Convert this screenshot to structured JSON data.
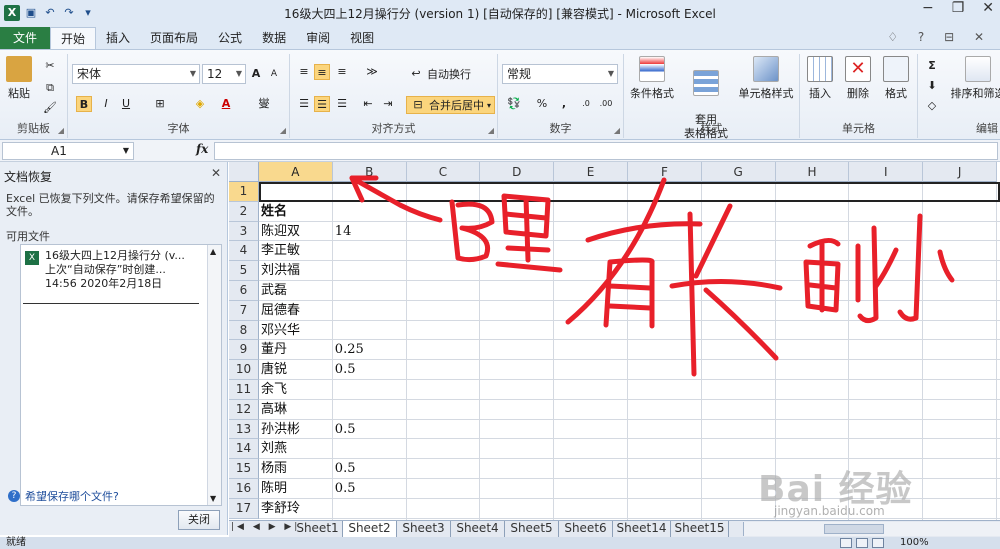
{
  "window": {
    "title": "16级大四上12月操行分 (version 1) [自动保存的]  [兼容模式] - Microsoft Excel",
    "controls": [
      "−",
      "❐",
      "✕"
    ]
  },
  "quick_access": {
    "save": "💾",
    "undo": "↶",
    "redo": "↷"
  },
  "ribbon_tabs": {
    "file": "文件",
    "items": [
      "开始",
      "插入",
      "页面布局",
      "公式",
      "数据",
      "审阅",
      "视图"
    ],
    "active": "开始",
    "right_icons": "♢ ? ⊟ ✕"
  },
  "ribbon": {
    "clipboard": {
      "label": "剪贴板",
      "paste": "粘贴"
    },
    "font": {
      "label": "字体",
      "name": "宋体",
      "size": "12",
      "bold": "B",
      "italic": "I",
      "underline": "U",
      "grow": "A",
      "shrink": "A",
      "wen": "燮"
    },
    "alignment": {
      "label": "对齐方式",
      "wrap": "自动换行",
      "merge": "合并后居中"
    },
    "number": {
      "label": "数字",
      "format": "常规",
      "percent": "%",
      "comma": ","
    },
    "styles": {
      "label": "样式",
      "conditional": "条件格式",
      "table": "套用\n表格格式",
      "cell_styles": "单元格样式"
    },
    "cells": {
      "label": "单元格",
      "insert": "插入",
      "delete": "删除",
      "format": "格式"
    },
    "editing": {
      "label": "编辑",
      "sort": "排序和筛选",
      "sum": "Σ"
    }
  },
  "formula_bar": {
    "name_box": "A1",
    "fx": "fx"
  },
  "recovery_pane": {
    "title": "文档恢复",
    "description": "Excel 已恢复下列文件。请保存希望保留的文件。",
    "available": "可用文件",
    "file": {
      "line1": "16级大四上12月操行分 (v...",
      "line2": "上次“自动保存”时创建...",
      "line3": "14:56 2020年2月18日"
    },
    "help": "希望保存哪个文件?",
    "close_button": "关闭"
  },
  "grid": {
    "columns": [
      "A",
      "B",
      "C",
      "D",
      "E",
      "F",
      "G",
      "H",
      "I",
      "J"
    ],
    "selected_column": "A",
    "rows": [
      {
        "num": "1",
        "a": "",
        "b": ""
      },
      {
        "num": "2",
        "a": "姓名",
        "b": "",
        "bold": true
      },
      {
        "num": "3",
        "a": "陈迎双",
        "b": "14"
      },
      {
        "num": "4",
        "a": "李正敏",
        "b": ""
      },
      {
        "num": "5",
        "a": "刘洪福",
        "b": ""
      },
      {
        "num": "6",
        "a": "武磊",
        "b": ""
      },
      {
        "num": "7",
        "a": "屈德春",
        "b": ""
      },
      {
        "num": "8",
        "a": "邓兴华",
        "b": ""
      },
      {
        "num": "9",
        "a": "董丹",
        "b": "0.25"
      },
      {
        "num": "10",
        "a": "唐锐",
        "b": "0.5"
      },
      {
        "num": "11",
        "a": "余飞",
        "b": ""
      },
      {
        "num": "12",
        "a": "高琳",
        "b": ""
      },
      {
        "num": "13",
        "a": "孙洪彬",
        "b": "0.5"
      },
      {
        "num": "14",
        "a": "刘燕",
        "b": ""
      },
      {
        "num": "15",
        "a": "杨雨",
        "b": "0.5"
      },
      {
        "num": "16",
        "a": "陈明",
        "b": "0.5"
      },
      {
        "num": "17",
        "a": "李舒玲",
        "b": ""
      }
    ]
  },
  "sheets": {
    "items": [
      "Sheet1",
      "Sheet2",
      "Sheet3",
      "Sheet4",
      "Sheet5",
      "Sheet6",
      "Sheet14",
      "Sheet15"
    ],
    "active": "Sheet2"
  },
  "status": {
    "ready": "就绪",
    "zoom": "100%"
  },
  "watermark": {
    "brand": "Bai 经验",
    "url": "jingyan.baidu.com"
  },
  "colors": {
    "accent_green": "#2a7e43",
    "selection": "#f9d98e",
    "ink_red": "#e8202a"
  }
}
